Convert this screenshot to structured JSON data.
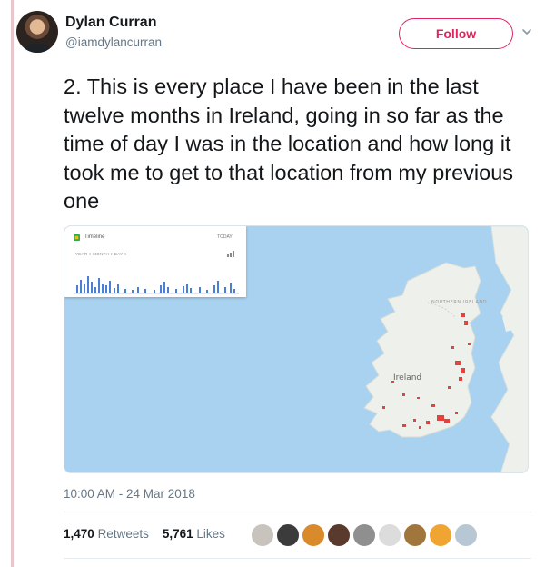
{
  "user": {
    "name": "Dylan Curran",
    "handle": "@iamdylancurran"
  },
  "actions": {
    "follow_label": "Follow"
  },
  "tweet": {
    "text": "2. This is every place I have been in the last twelve months in Ireland, going in so far as the time of day I was in the location and how long it took me to get to that location from my previous one",
    "timestamp": "10:00 AM - 24 Mar 2018"
  },
  "stats": {
    "retweets_count": "1,470",
    "retweets_label": "Retweets",
    "likes_count": "5,761",
    "likes_label": "Likes"
  },
  "media": {
    "timeline_title": "Timeline",
    "timeline_today": "TODAY",
    "timeline_controls": "YEAR ▾   MONTH ▾   DAY ▾",
    "map_label_country": "Ireland",
    "map_label_ni": "NORTHERN IRELAND",
    "colors": {
      "sea": "#a9d2f1",
      "land": "#eef0ec",
      "pin": "#e8403a",
      "bars": "#4a7fd4"
    }
  },
  "theme": {
    "accent": "#e0245e",
    "muted": "#657786",
    "text": "#14171a"
  },
  "icons": {
    "chevron": "chevron-down-icon",
    "avatar": "user-avatar"
  }
}
